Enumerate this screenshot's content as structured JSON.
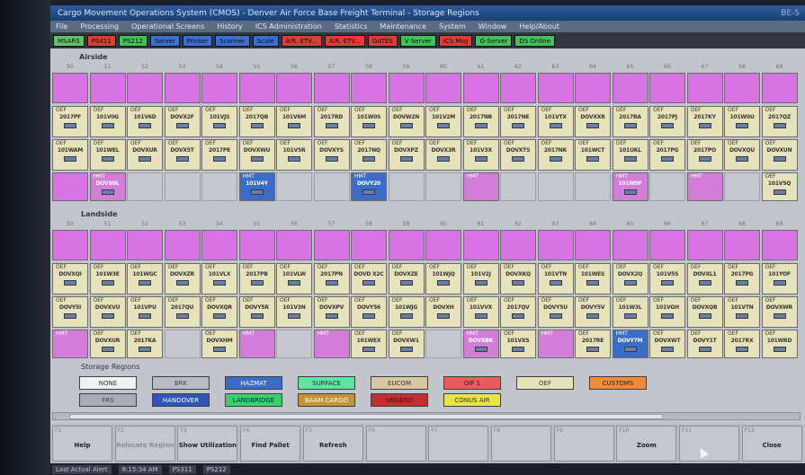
{
  "window": {
    "title": "Cargo Movement Operations System (CMOS) - Denver Air Force Base Freight Terminal - Storage Regions",
    "title_right": "BE-S"
  },
  "menu": [
    "File",
    "Processing",
    "Operational Screens",
    "History",
    "ICS Administration",
    "Statistics",
    "Maintenance",
    "System",
    "Window",
    "Help/About"
  ],
  "status_bar": [
    {
      "label": "MSARS",
      "color": "#62c46a"
    },
    {
      "label": "PS411",
      "color": "#e23b3b"
    },
    {
      "label": "PS212",
      "color": "#42c25a"
    },
    {
      "label": "Server",
      "color": "#3d6fd1"
    },
    {
      "label": "Printer",
      "color": "#3d6fd1"
    },
    {
      "label": "Scanner",
      "color": "#3d6fd1"
    },
    {
      "label": "Scale",
      "color": "#3d6fd1"
    },
    {
      "label": "AIR. ETV...",
      "color": "#e23b3b"
    },
    {
      "label": "AIR. ETV...",
      "color": "#e23b3b"
    },
    {
      "label": "GATES",
      "color": "#e23b3b"
    },
    {
      "label": "V Server",
      "color": "#42c25a"
    },
    {
      "label": "ICS Msg",
      "color": "#e23b3b"
    },
    {
      "label": "G-Server",
      "color": "#42c25a"
    },
    {
      "label": "DS Online",
      "color": "#42c25a"
    }
  ],
  "airside": {
    "label": "Airside",
    "columns": [
      "50",
      "51",
      "52",
      "53",
      "54",
      "55",
      "56",
      "57",
      "58",
      "59",
      "60",
      "61",
      "62",
      "63",
      "64",
      "65",
      "66",
      "67",
      "68",
      "69"
    ],
    "rows": [
      [
        {
          "t": "empty"
        },
        {
          "t": "empty"
        },
        {
          "t": "empty"
        },
        {
          "t": "empty"
        },
        {
          "t": "empty"
        },
        {
          "t": "empty"
        },
        {
          "t": "empty"
        },
        {
          "t": "empty"
        },
        {
          "t": "empty"
        },
        {
          "t": "empty"
        },
        {
          "t": "empty"
        },
        {
          "t": "empty"
        },
        {
          "t": "empty"
        },
        {
          "t": "empty"
        },
        {
          "t": "empty"
        },
        {
          "t": "empty"
        },
        {
          "t": "empty"
        },
        {
          "t": "empty"
        },
        {
          "t": "empty"
        },
        {
          "t": "empty"
        }
      ],
      [
        {
          "t": "oef",
          "c": "OEF",
          "id": "2017PF"
        },
        {
          "t": "oef",
          "c": "OEF",
          "id": "101V0G"
        },
        {
          "t": "oef",
          "c": "OEF",
          "id": "101V6D"
        },
        {
          "t": "oef",
          "c": "OEF",
          "id": "DOVX2F"
        },
        {
          "t": "oef",
          "c": "OEF",
          "id": "101VJS"
        },
        {
          "t": "oef",
          "c": "OEF",
          "id": "2017QB"
        },
        {
          "t": "oef",
          "c": "OEF",
          "id": "101V6M"
        },
        {
          "t": "oef",
          "c": "OEF",
          "id": "2017RD"
        },
        {
          "t": "oef",
          "c": "OEF",
          "id": "101W0S"
        },
        {
          "t": "oef",
          "c": "OEF",
          "id": "DOVW2N"
        },
        {
          "t": "oef",
          "c": "OEF",
          "id": "101V2M"
        },
        {
          "t": "oef",
          "c": "OEF",
          "id": "2017NB"
        },
        {
          "t": "oef",
          "c": "OEF",
          "id": "2017NE"
        },
        {
          "t": "oef",
          "c": "OEF",
          "id": "101VTX"
        },
        {
          "t": "oef",
          "c": "OEF",
          "id": "DOVXXR"
        },
        {
          "t": "oef",
          "c": "OEF",
          "id": "2017RA"
        },
        {
          "t": "oef",
          "c": "OEF",
          "id": "2017PJ"
        },
        {
          "t": "oef",
          "c": "OEF",
          "id": "2017KY"
        },
        {
          "t": "oef",
          "c": "OEF",
          "id": "101W0U"
        },
        {
          "t": "oef",
          "c": "OEF",
          "id": "2017QZ"
        }
      ],
      [
        {
          "t": "oef",
          "c": "OEF",
          "id": "101WAM"
        },
        {
          "t": "oef",
          "c": "OEF",
          "id": "101WEL"
        },
        {
          "t": "oef",
          "c": "OEF",
          "id": "DOVXUR"
        },
        {
          "t": "oef",
          "c": "OEF",
          "id": "DOVX5T"
        },
        {
          "t": "oef",
          "c": "OEF",
          "id": "2017PE"
        },
        {
          "t": "oef",
          "c": "OEF",
          "id": "DOVXWU"
        },
        {
          "t": "oef",
          "c": "OEF",
          "id": "101V5R"
        },
        {
          "t": "oef",
          "c": "OEF",
          "id": "DOVXYS"
        },
        {
          "t": "oef",
          "c": "OEF",
          "id": "2017NQ"
        },
        {
          "t": "oef",
          "c": "OEF",
          "id": "DOVXPZ"
        },
        {
          "t": "oef",
          "c": "OEF",
          "id": "DOVX3R"
        },
        {
          "t": "oef",
          "c": "OEF",
          "id": "101V3X"
        },
        {
          "t": "oef",
          "c": "OEF",
          "id": "DOVXTS"
        },
        {
          "t": "oef",
          "c": "OEF",
          "id": "2017NK"
        },
        {
          "t": "oef",
          "c": "OEF",
          "id": "101WCT"
        },
        {
          "t": "oef",
          "c": "OEF",
          "id": "101UKL"
        },
        {
          "t": "oef",
          "c": "OEF",
          "id": "2017PG"
        },
        {
          "t": "oef",
          "c": "OEF",
          "id": "2017PO"
        },
        {
          "t": "oef",
          "c": "OEF",
          "id": "DOVXQU"
        },
        {
          "t": "oef",
          "c": "OEF",
          "id": "DOVXUN"
        }
      ],
      [
        {
          "t": "empty"
        },
        {
          "t": "hmt",
          "c": "HMT",
          "id": "DOVX0L"
        },
        {
          "t": "gray"
        },
        {
          "t": "gray"
        },
        {
          "t": "gray"
        },
        {
          "t": "haz",
          "c": "HMT",
          "id": "101V4Y"
        },
        {
          "t": "gray"
        },
        {
          "t": "gray"
        },
        {
          "t": "haz",
          "c": "HMT",
          "id": "DOVY20"
        },
        {
          "t": "gray"
        },
        {
          "t": "gray"
        },
        {
          "t": "hmt",
          "c": "HMT",
          "id": ""
        },
        {
          "t": "gray"
        },
        {
          "t": "gray"
        },
        {
          "t": "gray"
        },
        {
          "t": "hmt",
          "c": "HMT",
          "id": "101W9F"
        },
        {
          "t": "gray"
        },
        {
          "t": "hmt",
          "c": "HMT",
          "id": ""
        },
        {
          "t": "gray"
        },
        {
          "t": "oef",
          "c": "OEF",
          "id": "101V5Q"
        }
      ]
    ]
  },
  "landside": {
    "label": "Landside",
    "columns": [
      "50",
      "51",
      "52",
      "53",
      "54",
      "55",
      "56",
      "57",
      "58",
      "59",
      "60",
      "61",
      "62",
      "63",
      "64",
      "65",
      "66",
      "67",
      "68",
      "69"
    ],
    "rows": [
      [
        {
          "t": "empty"
        },
        {
          "t": "empty"
        },
        {
          "t": "empty"
        },
        {
          "t": "empty"
        },
        {
          "t": "empty"
        },
        {
          "t": "empty"
        },
        {
          "t": "empty"
        },
        {
          "t": "empty"
        },
        {
          "t": "empty"
        },
        {
          "t": "empty"
        },
        {
          "t": "empty"
        },
        {
          "t": "empty"
        },
        {
          "t": "empty"
        },
        {
          "t": "empty"
        },
        {
          "t": "empty"
        },
        {
          "t": "empty"
        },
        {
          "t": "empty"
        },
        {
          "t": "empty"
        },
        {
          "t": "empty"
        },
        {
          "t": "empty"
        }
      ],
      [
        {
          "t": "oef",
          "c": "OEF",
          "id": "DOVXQI"
        },
        {
          "t": "oef",
          "c": "OEF",
          "id": "101W3E"
        },
        {
          "t": "oef",
          "c": "OEF",
          "id": "101WGC"
        },
        {
          "t": "oef",
          "c": "OEF",
          "id": "DOVXZR"
        },
        {
          "t": "oef",
          "c": "OEF",
          "id": "101VLX"
        },
        {
          "t": "oef",
          "c": "OEF",
          "id": "2017PB"
        },
        {
          "t": "oef",
          "c": "OEF",
          "id": "101VLW"
        },
        {
          "t": "oef",
          "c": "OEF",
          "id": "2017PN"
        },
        {
          "t": "oef",
          "c": "OEF",
          "id": "DOVD X2C"
        },
        {
          "t": "oef",
          "c": "OEF",
          "id": "DOVXZE"
        },
        {
          "t": "oef",
          "c": "OEF",
          "id": "101WJQ"
        },
        {
          "t": "oef",
          "c": "OEF",
          "id": "101V2J"
        },
        {
          "t": "oef",
          "c": "OEF",
          "id": "DOVXKQ"
        },
        {
          "t": "oef",
          "c": "OEF",
          "id": "101VTN"
        },
        {
          "t": "oef",
          "c": "OEF",
          "id": "101WES"
        },
        {
          "t": "oef",
          "c": "OEF",
          "id": "DOVX2Q"
        },
        {
          "t": "oef",
          "c": "OEF",
          "id": "101V5S"
        },
        {
          "t": "oef",
          "c": "OEF",
          "id": "DOVXL1"
        },
        {
          "t": "oef",
          "c": "OEF",
          "id": "2017PG"
        },
        {
          "t": "oef",
          "c": "OEF",
          "id": "101YOF"
        }
      ],
      [
        {
          "t": "oef",
          "c": "OEF",
          "id": "DOVY5I"
        },
        {
          "t": "oef",
          "c": "OEF",
          "id": "DOVXVU"
        },
        {
          "t": "oef",
          "c": "OEF",
          "id": "101VPU"
        },
        {
          "t": "oef",
          "c": "OEF",
          "id": "2017QU"
        },
        {
          "t": "oef",
          "c": "OEF",
          "id": "DOVXQR"
        },
        {
          "t": "oef",
          "c": "OEF",
          "id": "DOVY5R"
        },
        {
          "t": "oef",
          "c": "OEF",
          "id": "101V3N"
        },
        {
          "t": "oef",
          "c": "OEF",
          "id": "DOVXPV"
        },
        {
          "t": "oef",
          "c": "OEF",
          "id": "DOVY56"
        },
        {
          "t": "oef",
          "c": "OEF",
          "id": "101WJG"
        },
        {
          "t": "oef",
          "c": "OEF",
          "id": "DOVXH"
        },
        {
          "t": "oef",
          "c": "OEF",
          "id": "101VVX"
        },
        {
          "t": "oef",
          "c": "OEF",
          "id": "2017QV"
        },
        {
          "t": "oef",
          "c": "OEF",
          "id": "DOVY5U"
        },
        {
          "t": "oef",
          "c": "OEF",
          "id": "DOVY5V"
        },
        {
          "t": "oef",
          "c": "OEF",
          "id": "101W3L"
        },
        {
          "t": "oef",
          "c": "OEF",
          "id": "101VGH"
        },
        {
          "t": "oef",
          "c": "OEF",
          "id": "DOVXQB"
        },
        {
          "t": "oef",
          "c": "OEF",
          "id": "101VTN"
        },
        {
          "t": "oef",
          "c": "OEF",
          "id": "DOVXWR"
        }
      ],
      [
        {
          "t": "hmt",
          "c": "HMT",
          "id": ""
        },
        {
          "t": "oef",
          "c": "OEF",
          "id": "DOVXUR"
        },
        {
          "t": "oef",
          "c": "OEF",
          "id": "2017KA"
        },
        {
          "t": "gray"
        },
        {
          "t": "oef",
          "c": "OEF",
          "id": "DOVXHM"
        },
        {
          "t": "hmt",
          "c": "HMT",
          "id": ""
        },
        {
          "t": "gray"
        },
        {
          "t": "hmt",
          "c": "HMT",
          "id": ""
        },
        {
          "t": "oef",
          "c": "OEF",
          "id": "101WEX"
        },
        {
          "t": "oef",
          "c": "OEF",
          "id": "DOVXW1"
        },
        {
          "t": "gray"
        },
        {
          "t": "hmt",
          "c": "HMT",
          "id": "DOVXBK"
        },
        {
          "t": "oef",
          "c": "OEF",
          "id": "101VXS"
        },
        {
          "t": "hmt",
          "c": "HMT",
          "id": ""
        },
        {
          "t": "oef",
          "c": "OEF",
          "id": "2017RE"
        },
        {
          "t": "haz",
          "c": "HMT",
          "id": "DOVY7M"
        },
        {
          "t": "oef",
          "c": "OEF",
          "id": "DOVXWT"
        },
        {
          "t": "oef",
          "c": "OEF",
          "id": "DOVY1T"
        },
        {
          "t": "oef",
          "c": "OEF",
          "id": "2017RX"
        },
        {
          "t": "oef",
          "c": "OEF",
          "id": "101WRD"
        }
      ]
    ]
  },
  "legend": {
    "title": "Storage Regions",
    "items": [
      {
        "label": "NONE",
        "bg": "#f1f2f4",
        "fg": "#333"
      },
      {
        "label": "BRK",
        "bg": "#b9bcc4",
        "fg": "#444"
      },
      {
        "label": "HAZMAT",
        "bg": "#3b6dc8",
        "fg": "#ffffff"
      },
      {
        "label": "SURFACE",
        "bg": "#5fe3a3",
        "fg": "#234"
      },
      {
        "label": "EUCOM",
        "bg": "#d9c7a3",
        "fg": "#333"
      },
      {
        "label": "OIF 1",
        "bg": "#ea5c5c",
        "fg": "#222"
      },
      {
        "label": "OEF",
        "bg": "#e6e3bb",
        "fg": "#333"
      },
      {
        "label": "CUSTOMS",
        "bg": "#f08b3b",
        "fg": "#222"
      },
      {
        "label": "FRS",
        "bg": "#a9acb6",
        "fg": "#444"
      },
      {
        "label": "HANDOVER",
        "bg": "#2d56b8",
        "fg": "#ffffff"
      },
      {
        "label": "LANDBRIDGE",
        "bg": "#39d06f",
        "fg": "#123"
      },
      {
        "label": "BAAM CARGO",
        "bg": "#c69432",
        "fg": "#fff"
      },
      {
        "label": "UNGERD",
        "bg": "#c42e2e",
        "fg": "#222"
      },
      {
        "label": "CONUS AIR",
        "bg": "#e8e34a",
        "fg": "#333"
      }
    ]
  },
  "fkeys": [
    {
      "num": "F1",
      "label": "Help",
      "enabled": true
    },
    {
      "num": "F2",
      "label": "Relocate Region",
      "enabled": false
    },
    {
      "num": "F3",
      "label": "Show Utilization",
      "enabled": true
    },
    {
      "num": "F4",
      "label": "Find Pallet",
      "enabled": true
    },
    {
      "num": "F5",
      "label": "Refresh",
      "enabled": true
    },
    {
      "num": "F6",
      "label": "",
      "enabled": false
    },
    {
      "num": "F7",
      "label": "",
      "enabled": false
    },
    {
      "num": "F8",
      "label": "",
      "enabled": false
    },
    {
      "num": "F9",
      "label": "",
      "enabled": false
    },
    {
      "num": "F10",
      "label": "Zoom",
      "enabled": true
    },
    {
      "num": "F11",
      "label": "",
      "enabled": false
    },
    {
      "num": "F12",
      "label": "Close",
      "enabled": true
    }
  ],
  "taskbar": {
    "alert": "Last Actual Alert",
    "time": "8:15:34 AM",
    "station": "PS311",
    "user": "PS212"
  }
}
